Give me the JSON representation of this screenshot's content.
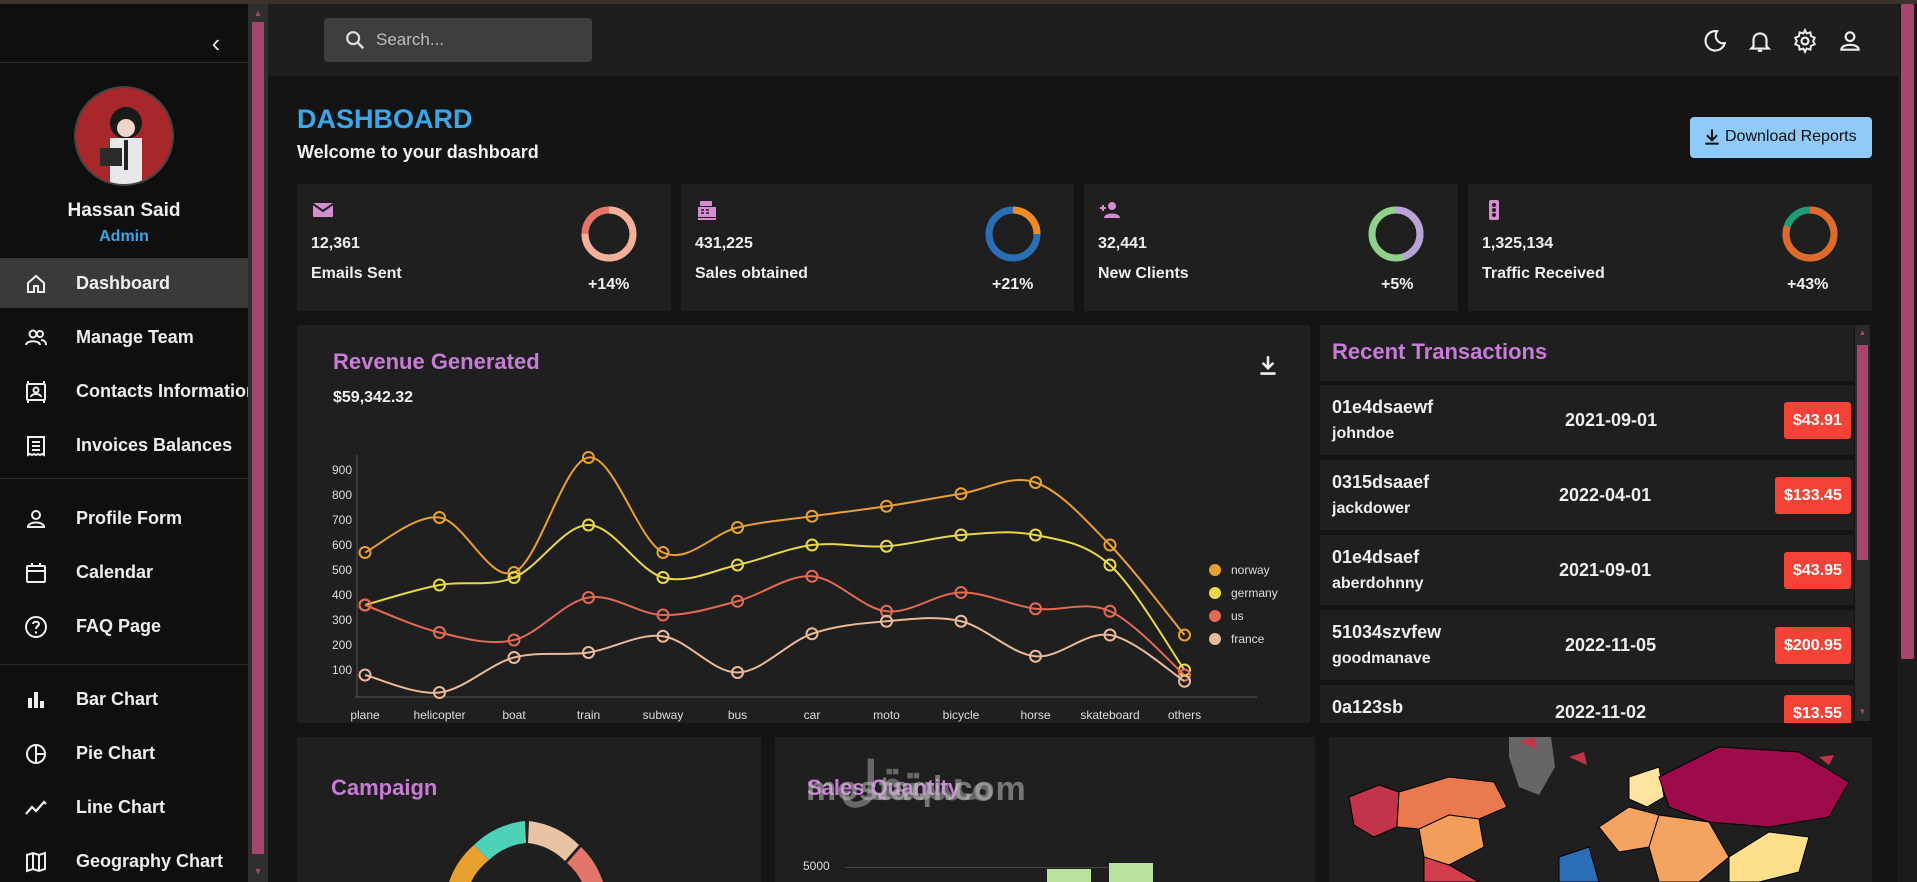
{
  "sidebar": {
    "collapse_icon": "chevron-left-icon",
    "user": {
      "name": "Hassan Said",
      "role": "Admin"
    },
    "items": [
      {
        "label": "Dashboard",
        "icon": "home-icon",
        "active": true
      },
      {
        "label": "Manage Team",
        "icon": "people-icon"
      },
      {
        "label": "Contacts Information",
        "icon": "contacts-icon"
      },
      {
        "label": "Invoices Balances",
        "icon": "receipt-icon"
      },
      {
        "label": "Profile Form",
        "icon": "person-icon"
      },
      {
        "label": "Calendar",
        "icon": "calendar-icon"
      },
      {
        "label": "FAQ Page",
        "icon": "help-icon"
      },
      {
        "label": "Bar Chart",
        "icon": "bar-chart-icon"
      },
      {
        "label": "Pie Chart",
        "icon": "pie-chart-icon"
      },
      {
        "label": "Line Chart",
        "icon": "line-chart-icon"
      },
      {
        "label": "Geography Chart",
        "icon": "map-icon"
      }
    ]
  },
  "topbar": {
    "search_placeholder": "Search...",
    "icons": [
      "moon-icon",
      "bell-icon",
      "gear-icon",
      "user-icon"
    ]
  },
  "header": {
    "title": "DASHBOARD",
    "subtitle": "Welcome to your dashboard",
    "download_label": "Download Reports"
  },
  "stats": [
    {
      "value": "12,361",
      "label": "Emails Sent",
      "increase": "+14%",
      "progress": 0.75,
      "icon": "email-icon"
    },
    {
      "value": "431,225",
      "label": "Sales obtained",
      "increase": "+21%",
      "progress": 0.25,
      "icon": "point-of-sale-icon"
    },
    {
      "value": "32,441",
      "label": "New Clients",
      "increase": "+5%",
      "progress": 0.45,
      "icon": "person-add-icon"
    },
    {
      "value": "1,325,134",
      "label": "Traffic Received",
      "increase": "+43%",
      "progress": 0.8,
      "icon": "traffic-icon"
    }
  ],
  "revenue": {
    "title": "Revenue Generated",
    "amount": "$59,342.32"
  },
  "chart_data": {
    "type": "line",
    "categories": [
      "plane",
      "helicopter",
      "boat",
      "train",
      "subway",
      "bus",
      "car",
      "moto",
      "bicycle",
      "horse",
      "skateboard",
      "others"
    ],
    "yticks": [
      100,
      200,
      300,
      400,
      500,
      600,
      700,
      800,
      900
    ],
    "ylim": [
      0,
      960
    ],
    "legend_position": "right",
    "series": [
      {
        "name": "norway",
        "color": "#e8a030",
        "values": [
          570,
          710,
          490,
          950,
          570,
          670,
          715,
          755,
          805,
          850,
          600,
          240
        ]
      },
      {
        "name": "germany",
        "color": "#e8d84a",
        "values": [
          360,
          440,
          470,
          680,
          470,
          520,
          600,
          595,
          640,
          640,
          520,
          100
        ]
      },
      {
        "name": "us",
        "color": "#e26a55",
        "values": [
          360,
          250,
          220,
          390,
          320,
          375,
          475,
          335,
          410,
          345,
          335,
          80
        ]
      },
      {
        "name": "france",
        "color": "#e9b99a",
        "values": [
          80,
          10,
          150,
          170,
          235,
          90,
          245,
          295,
          295,
          155,
          240,
          55
        ]
      }
    ]
  },
  "transactions": {
    "title": "Recent Transactions",
    "rows": [
      {
        "id": "01e4dsaewf",
        "user": "johndoe",
        "date": "2021-09-01",
        "cost": "$43.91"
      },
      {
        "id": "0315dsaaef",
        "user": "jackdower",
        "date": "2022-04-01",
        "cost": "$133.45"
      },
      {
        "id": "01e4dsaef",
        "user": "aberdohnny",
        "date": "2021-09-01",
        "cost": "$43.95"
      },
      {
        "id": "51034szvfew",
        "user": "goodmanave",
        "date": "2022-11-05",
        "cost": "$200.95"
      },
      {
        "id": "0a123sb",
        "user": "",
        "date": "2022-11-02",
        "cost": "$13.55"
      }
    ]
  },
  "bottom": {
    "campaign_title": "Campaign",
    "sales_title": "Sales Quantity",
    "sales_ytick": "5000"
  },
  "watermark": {
    "latin": "mostaql.com",
    "arabic": "مستقل"
  },
  "colors": {
    "accent": "#3da6e8",
    "section_title": "#c77dd6",
    "scrollbar": "#a6466f",
    "cost_badge": "#f44336",
    "button": "#90caf9"
  }
}
